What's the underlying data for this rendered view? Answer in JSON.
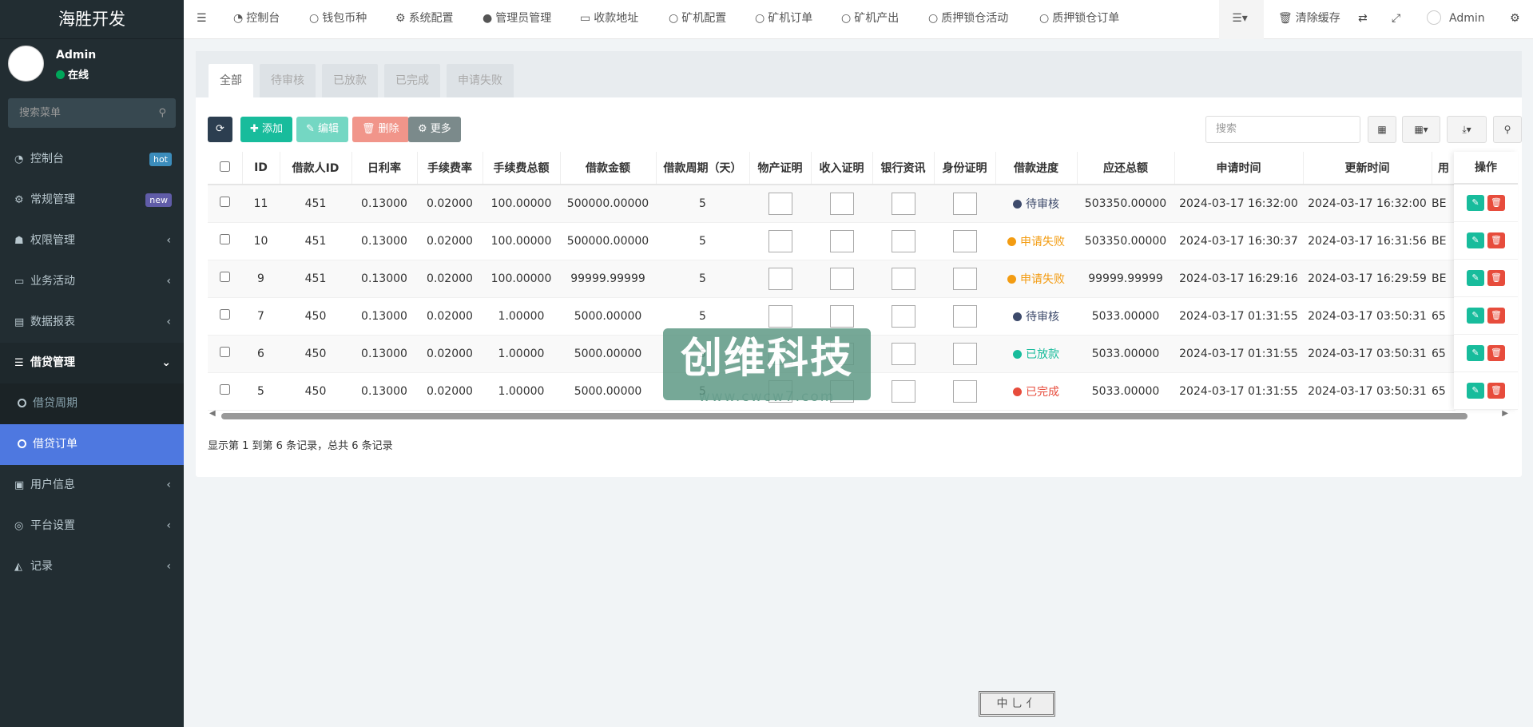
{
  "sidebar": {
    "logo": "海胜开发",
    "user_name": "Admin",
    "user_status": "在线",
    "search_placeholder": "搜索菜单",
    "items": [
      {
        "label": "控制台",
        "icon": "dashboard-icon",
        "badge": "hot",
        "badge_color": "#3c8dbc"
      },
      {
        "label": "常规管理",
        "icon": "cogs-icon",
        "badge": "new",
        "badge_color": "#605ca8"
      },
      {
        "label": "权限管理",
        "icon": "group-icon"
      },
      {
        "label": "业务活动",
        "icon": "id-card-icon"
      },
      {
        "label": "数据报表",
        "icon": "file-icon"
      },
      {
        "label": "借贷管理",
        "icon": "list-icon"
      },
      {
        "label": "用户信息",
        "icon": "address-book-icon"
      },
      {
        "label": "平台设置",
        "icon": "gear-icon"
      },
      {
        "label": "记录",
        "icon": "area-chart-icon"
      }
    ],
    "subitems": [
      {
        "label": "借贷周期"
      },
      {
        "label": "借贷订单"
      }
    ]
  },
  "topnav": {
    "items": [
      "控制台",
      "钱包币种",
      "系统配置",
      "管理员管理",
      "收款地址",
      "矿机配置",
      "矿机订单",
      "矿机产出",
      "质押锁仓活动",
      "质押锁仓订单"
    ],
    "clear_cache": "清除缓存",
    "admin": "Admin"
  },
  "tabs": [
    "全部",
    "待审核",
    "已放款",
    "已完成",
    "申请失败"
  ],
  "toolbar": {
    "add": "添加",
    "edit": "编辑",
    "delete": "删除",
    "more": "更多",
    "search_placeholder": "搜索"
  },
  "table": {
    "headers": [
      "ID",
      "借款人ID",
      "日利率",
      "手续费率",
      "手续费总额",
      "借款金额",
      "借款周期（天）",
      "物产证明",
      "收入证明",
      "银行资讯",
      "身份证明",
      "借款进度",
      "应还总额",
      "申请时间",
      "更新时间",
      "用"
    ],
    "ops_header": "操作",
    "rows": [
      {
        "id": "11",
        "uid": "451",
        "rate": "0.13000",
        "fee_rate": "0.02000",
        "fee_total": "100.00000",
        "amount": "500000.00000",
        "days": "5",
        "status": "待审核",
        "status_color": "#3d4a6b",
        "repay": "503350.00000",
        "apply": "2024-03-17 16:32:00",
        "update": "2024-03-17 16:32:00",
        "extra": "BE"
      },
      {
        "id": "10",
        "uid": "451",
        "rate": "0.13000",
        "fee_rate": "0.02000",
        "fee_total": "100.00000",
        "amount": "500000.00000",
        "days": "5",
        "status": "申请失败",
        "status_color": "#f39c12",
        "repay": "503350.00000",
        "apply": "2024-03-17 16:30:37",
        "update": "2024-03-17 16:31:56",
        "extra": "BE"
      },
      {
        "id": "9",
        "uid": "451",
        "rate": "0.13000",
        "fee_rate": "0.02000",
        "fee_total": "100.00000",
        "amount": "99999.99999",
        "days": "5",
        "status": "申请失败",
        "status_color": "#f39c12",
        "repay": "99999.99999",
        "apply": "2024-03-17 16:29:16",
        "update": "2024-03-17 16:29:59",
        "extra": "BE"
      },
      {
        "id": "7",
        "uid": "450",
        "rate": "0.13000",
        "fee_rate": "0.02000",
        "fee_total": "1.00000",
        "amount": "5000.00000",
        "days": "5",
        "status": "待审核",
        "status_color": "#3d4a6b",
        "repay": "5033.00000",
        "apply": "2024-03-17 01:31:55",
        "update": "2024-03-17 03:50:31",
        "extra": "65"
      },
      {
        "id": "6",
        "uid": "450",
        "rate": "0.13000",
        "fee_rate": "0.02000",
        "fee_total": "1.00000",
        "amount": "5000.00000",
        "days": "5",
        "status": "已放款",
        "status_color": "#18bc9c",
        "repay": "5033.00000",
        "apply": "2024-03-17 01:31:55",
        "update": "2024-03-17 03:50:31",
        "extra": "65"
      },
      {
        "id": "5",
        "uid": "450",
        "rate": "0.13000",
        "fee_rate": "0.02000",
        "fee_total": "1.00000",
        "amount": "5000.00000",
        "days": "5",
        "status": "已完成",
        "status_color": "#e74c3c",
        "repay": "5033.00000",
        "apply": "2024-03-17 01:31:55",
        "update": "2024-03-17 03:50:31",
        "extra": "65"
      }
    ]
  },
  "pagination_text": "显示第 1 到第 6 条记录，总共 6 条记录",
  "watermark": {
    "main": "创维科技",
    "url": "www.cwcw7.com"
  },
  "stamp": "中 ⺃ ⺅"
}
